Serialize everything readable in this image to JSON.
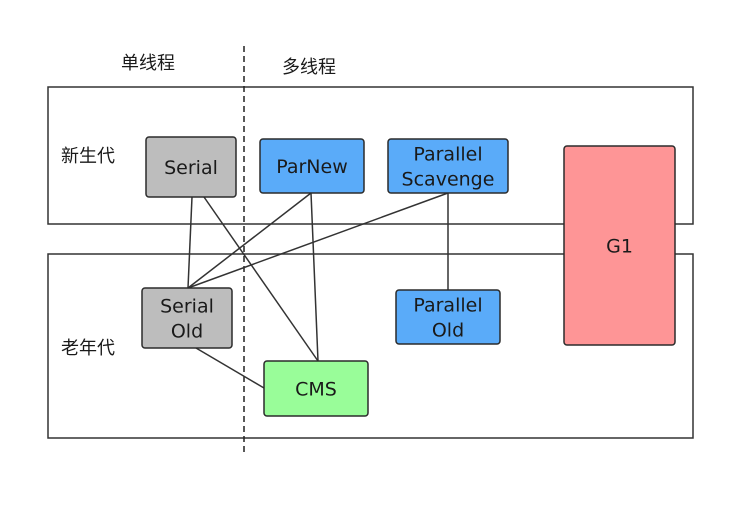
{
  "headers": {
    "single_thread": "单线程",
    "multi_thread": "多线程"
  },
  "regions": {
    "young": "新生代",
    "old": "老年代"
  },
  "nodes": {
    "serial": {
      "lines": [
        "Serial"
      ],
      "color": "#bdbdbd"
    },
    "parnew": {
      "lines": [
        "ParNew"
      ],
      "color": "#5aabf9"
    },
    "parallel_scavenge": {
      "lines": [
        "Parallel",
        "Scavenge"
      ],
      "color": "#5aabf9"
    },
    "serial_old": {
      "lines": [
        "Serial",
        "Old"
      ],
      "color": "#bdbdbd"
    },
    "parallel_old": {
      "lines": [
        "Parallel",
        "Old"
      ],
      "color": "#5aabf9"
    },
    "cms": {
      "lines": [
        "CMS"
      ],
      "color": "#99fd99"
    },
    "g1": {
      "lines": [
        "G1"
      ],
      "color": "#fe9596"
    }
  },
  "connections": [
    [
      "serial",
      "serial_old"
    ],
    [
      "serial",
      "cms"
    ],
    [
      "parnew",
      "serial_old"
    ],
    [
      "parnew",
      "cms"
    ],
    [
      "parallel_scavenge",
      "serial_old"
    ],
    [
      "parallel_scavenge",
      "parallel_old"
    ],
    [
      "serial_old",
      "cms"
    ]
  ]
}
